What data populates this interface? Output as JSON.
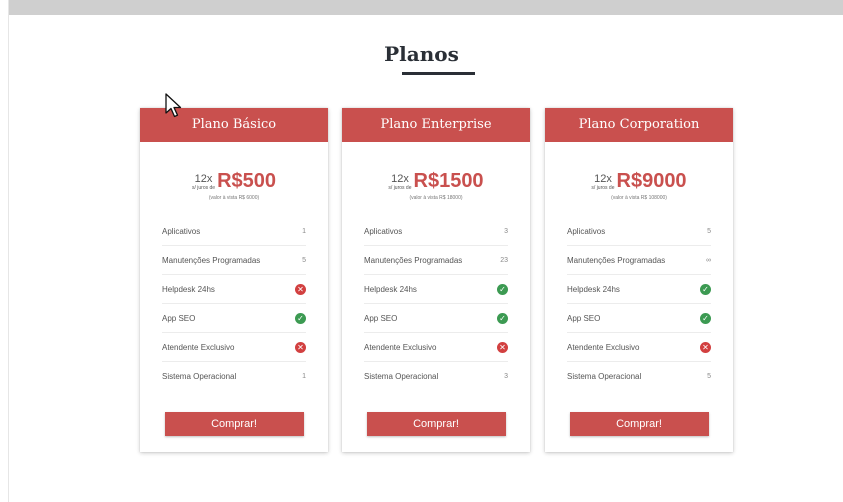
{
  "page": {
    "title": "Planos"
  },
  "plans": [
    {
      "name": "Plano Básico",
      "installments": "12x",
      "interest_note": "s/ juros de",
      "price": "R$500",
      "total_note": "(valor à vista R$ 6000)",
      "features": [
        {
          "label": "Aplicativos",
          "value": "1"
        },
        {
          "label": "Manutenções Programadas",
          "value": "5"
        },
        {
          "label": "Helpdesk 24hs",
          "status": "no"
        },
        {
          "label": "App SEO",
          "status": "yes"
        },
        {
          "label": "Atendente Exclusivo",
          "status": "no"
        },
        {
          "label": "Sistema Operacional",
          "value": "1"
        }
      ],
      "button_label": "Comprar!"
    },
    {
      "name": "Plano Enterprise",
      "installments": "12x",
      "interest_note": "s/ juros de",
      "price": "R$1500",
      "total_note": "(valor à vista R$ 18000)",
      "features": [
        {
          "label": "Aplicativos",
          "value": "3"
        },
        {
          "label": "Manutenções Programadas",
          "value": "23"
        },
        {
          "label": "Helpdesk 24hs",
          "status": "yes"
        },
        {
          "label": "App SEO",
          "status": "yes"
        },
        {
          "label": "Atendente Exclusivo",
          "status": "no"
        },
        {
          "label": "Sistema Operacional",
          "value": "3"
        }
      ],
      "button_label": "Comprar!"
    },
    {
      "name": "Plano Corporation",
      "installments": "12x",
      "interest_note": "s/ juros de",
      "price": "R$9000",
      "total_note": "(valor à vista R$ 108000)",
      "features": [
        {
          "label": "Aplicativos",
          "value": "5"
        },
        {
          "label": "Manutenções Programadas",
          "value": "∞"
        },
        {
          "label": "Helpdesk 24hs",
          "status": "yes"
        },
        {
          "label": "App SEO",
          "status": "yes"
        },
        {
          "label": "Atendente Exclusivo",
          "status": "no"
        },
        {
          "label": "Sistema Operacional",
          "value": "5"
        }
      ],
      "button_label": "Comprar!"
    }
  ],
  "colors": {
    "accent": "#c9504e",
    "title": "#2a2f36",
    "yes": "#3c9a52",
    "no": "#d24040"
  },
  "icons": {
    "yes": "check-circle-icon",
    "no": "x-circle-icon",
    "cursor": "mouse-pointer-icon"
  }
}
